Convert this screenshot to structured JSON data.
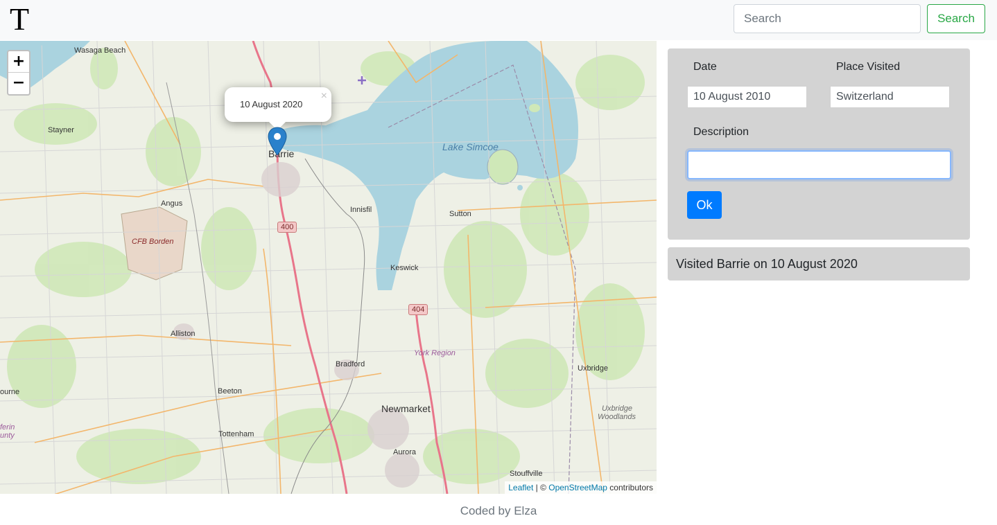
{
  "navbar": {
    "brand": "T",
    "search_placeholder": "Search",
    "search_button": "Search"
  },
  "map": {
    "zoom_in": "+",
    "zoom_out": "−",
    "popup_text": "10 August 2020",
    "popup_close": "×",
    "attribution": {
      "leaflet": "Leaflet",
      "separator": " | © ",
      "osm": "OpenStreetMap",
      "suffix": " contributors"
    },
    "labels": {
      "wasaga_beach": "Wasaga Beach",
      "stayner": "Stayner",
      "barrie": "Barrie",
      "lake_simcoe": "Lake Simcoe",
      "angus": "Angus",
      "cfb_borden": "CFB Borden",
      "innisfil": "Innisfil",
      "sutton": "Sutton",
      "keswick": "Keswick",
      "york_region": "York Region",
      "alliston": "Alliston",
      "bradford": "Bradford",
      "uxbridge": "Uxbridge",
      "beeton": "Beeton",
      "newmarket": "Newmarket",
      "uxbridge_woodlands_1": "Uxbridge",
      "uxbridge_woodlands_2": "Woodlands",
      "tottenham": "Tottenham",
      "aurora": "Aurora",
      "stouffville": "Stouffville",
      "ourne": "ourne",
      "ferin": "ferin",
      "unty": "unty",
      "hwy_400": "400",
      "hwy_404": "404"
    }
  },
  "form": {
    "date_label": "Date",
    "place_label": "Place Visited",
    "date_value": "10 August 2010",
    "place_value": "Switzerland",
    "description_label": "Description",
    "description_value": "",
    "ok_button": "Ok"
  },
  "visits": [
    {
      "text": "Visited Barrie on 10 August 2020"
    }
  ],
  "footer": {
    "text": "Coded by Elza"
  },
  "colors": {
    "primary": "#007bff",
    "success": "#28a745",
    "panel": "#d3d3d3",
    "water": "#aad3df",
    "marker": "#2a81cb"
  }
}
